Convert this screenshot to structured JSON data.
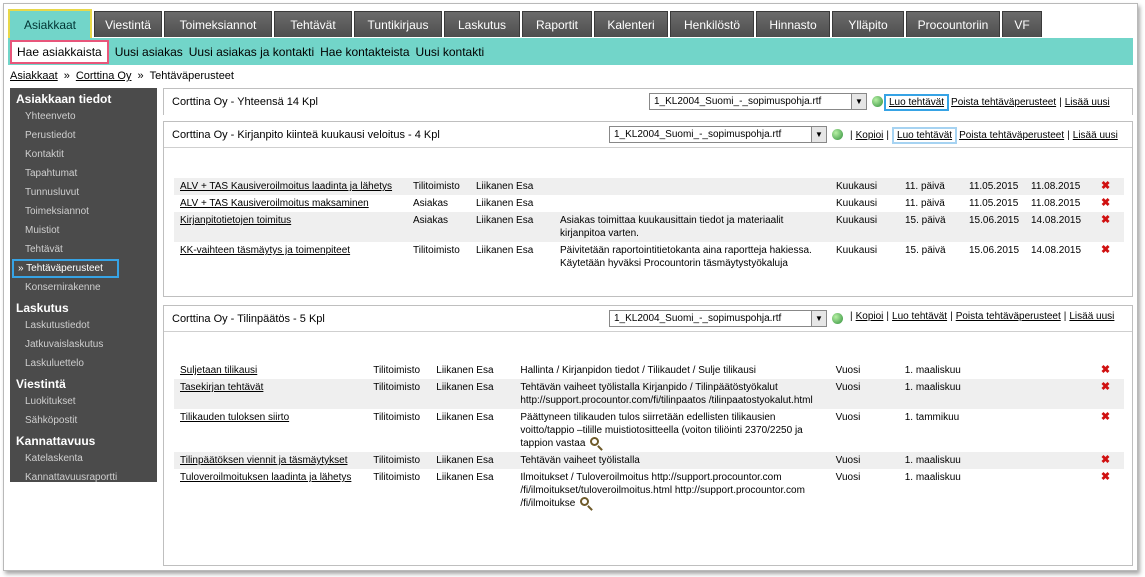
{
  "top_tabs": [
    "Asiakkaat",
    "Viestintä",
    "Toimeksiannot",
    "Tehtävät",
    "Tuntikirjaus",
    "Laskutus",
    "Raportit",
    "Kalenteri",
    "Henkilöstö",
    "Hinnasto",
    "Ylläpito",
    "Procountoriin",
    "VF"
  ],
  "sub_nav": [
    "Hae asiakkaista",
    "Uusi asiakas",
    "Uusi asiakas ja kontakti",
    "Hae kontakteista",
    "Uusi kontakti"
  ],
  "breadcrumb": {
    "root": "Asiakkaat",
    "customer": "Corttina Oy",
    "current": "Tehtäväperusteet",
    "sep": "»"
  },
  "sidebar": {
    "sections": [
      {
        "title": "Asiakkaan tiedot",
        "items": [
          "Yhteenveto",
          "Perustiedot",
          "Kontaktit",
          "Tapahtumat",
          "Tunnusluvut",
          "Toimeksiannot",
          "Muistiot",
          "Tehtävät",
          "» Tehtäväperusteet",
          "Konsernirakenne"
        ]
      },
      {
        "title": "Laskutus",
        "items": [
          "Laskutustiedot",
          "Jatkuvaislaskutus",
          "Laskuluettelo"
        ]
      },
      {
        "title": "Viestintä",
        "items": [
          "Luokitukset",
          "Sähköpostit"
        ]
      },
      {
        "title": "Kannattavuus",
        "items": [
          "Katelaskenta",
          "Kannattavuusraportti"
        ]
      }
    ]
  },
  "panel1": {
    "title": "Corttina Oy - Yhteensä 14 Kpl",
    "template": "1_KL2004_Suomi_-_sopimuspohja.rtf",
    "links": [
      "Luo tehtävät",
      "Poista tehtäväperusteet",
      "Lisää uusi"
    ],
    "pipe": "|"
  },
  "panel2": {
    "title": "Corttina Oy - Kirjanpito kiinteä kuukausi veloitus - 4 Kpl",
    "template": "1_KL2004_Suomi_-_sopimuspohja.rtf",
    "links": [
      "Kopioi",
      "Luo tehtävät",
      "Poista tehtäväperusteet",
      "Lisää uusi"
    ],
    "pipe": "|",
    "rows": [
      {
        "name": "ALV + TAS Kausiveroilmoitus laadinta ja lähetys",
        "responsible": "Tilitoimisto",
        "person": "Liikanen Esa",
        "desc": "",
        "period": "Kuukausi",
        "day": "11. päivä",
        "start": "11.05.2015",
        "end": "11.08.2015",
        "del": "✖"
      },
      {
        "name": "ALV + TAS Kausiveroilmoitus maksaminen",
        "responsible": "Asiakas",
        "person": "Liikanen Esa",
        "desc": "",
        "period": "Kuukausi",
        "day": "11. päivä",
        "start": "11.05.2015",
        "end": "11.08.2015",
        "del": "✖"
      },
      {
        "name": "Kirjanpitotietojen toimitus",
        "responsible": "Asiakas",
        "person": "Liikanen Esa",
        "desc": "Asiakas toimittaa kuukausittain tiedot ja materiaalit kirjanpitoa varten.",
        "period": "Kuukausi",
        "day": "15. päivä",
        "start": "15.06.2015",
        "end": "14.08.2015",
        "del": "✖"
      },
      {
        "name": "KK-vaihteen täsmäytys ja toimenpiteet",
        "responsible": "Tilitoimisto",
        "person": "Liikanen Esa",
        "desc": "Päivitetään raportointitietokanta aina raporttejа hakiessa. Käytetään hyväksi Procountorin täsmäytystyökaluja",
        "period": "Kuukausi",
        "day": "15. päivä",
        "start": "15.06.2015",
        "end": "14.08.2015",
        "del": "✖"
      }
    ]
  },
  "panel3": {
    "title": "Corttina Oy - Tilinpäätös - 5 Kpl",
    "template": "1_KL2004_Suomi_-_sopimuspohja.rtf",
    "links": [
      "Kopioi",
      "Luo tehtävät",
      "Poista tehtäväperusteet",
      "Lisää uusi"
    ],
    "pipe": "|",
    "rows": [
      {
        "name": "Suljetaan tilikausi",
        "responsible": "Tilitoimisto",
        "person": "Liikanen Esa",
        "desc": "Hallinta / Kirjanpidon tiedot / Tilikaudet / Sulje tilikausi",
        "period": "Vuosi",
        "day": "1. maaliskuu",
        "start": "",
        "end": "",
        "del": "✖"
      },
      {
        "name": "Tasekirjan tehtävät",
        "responsible": "Tilitoimisto",
        "person": "Liikanen Esa",
        "desc": "Tehtävän vaiheet työlistalla Kirjanpido / Tilinpäätöstyökalut http://support.procountor.com/fi/tilinpaatos /tilinpaatostyokalut.html",
        "period": "Vuosi",
        "day": "1. maaliskuu",
        "start": "",
        "end": "",
        "del": "✖"
      },
      {
        "name": "Tilikauden tuloksen siirto",
        "responsible": "Tilitoimisto",
        "person": "Liikanen Esa",
        "desc": "Päättyneen tilikauden tulos siirretään edellisten tilikausien voitto/tappio –tilille muistiotositteella (voiton tiliöinti 2370/2250 ja tappion vastaa",
        "period": "Vuosi",
        "day": "1. tammikuu",
        "start": "",
        "end": "",
        "del": "✖",
        "more": true
      },
      {
        "name": "Tilinpäätöksen viennit ja täsmäytykset",
        "responsible": "Tilitoimisto",
        "person": "Liikanen Esa",
        "desc": "Tehtävän vaiheet työlistalla",
        "period": "Vuosi",
        "day": "1. maaliskuu",
        "start": "",
        "end": "",
        "del": "✖"
      },
      {
        "name": "Tuloveroilmoituksen laadinta ja lähetys",
        "responsible": "Tilitoimisto",
        "person": "Liikanen Esa",
        "desc": "Ilmoitukset / Tuloveroilmoitus http://support.procountor.com /fi/ilmoitukset/tuloveroilmoitus.html http://support.procountor.com /fi/ilmoitukse",
        "period": "Vuosi",
        "day": "1. maaliskuu",
        "start": "",
        "end": "",
        "del": "✖",
        "more": true
      }
    ]
  }
}
